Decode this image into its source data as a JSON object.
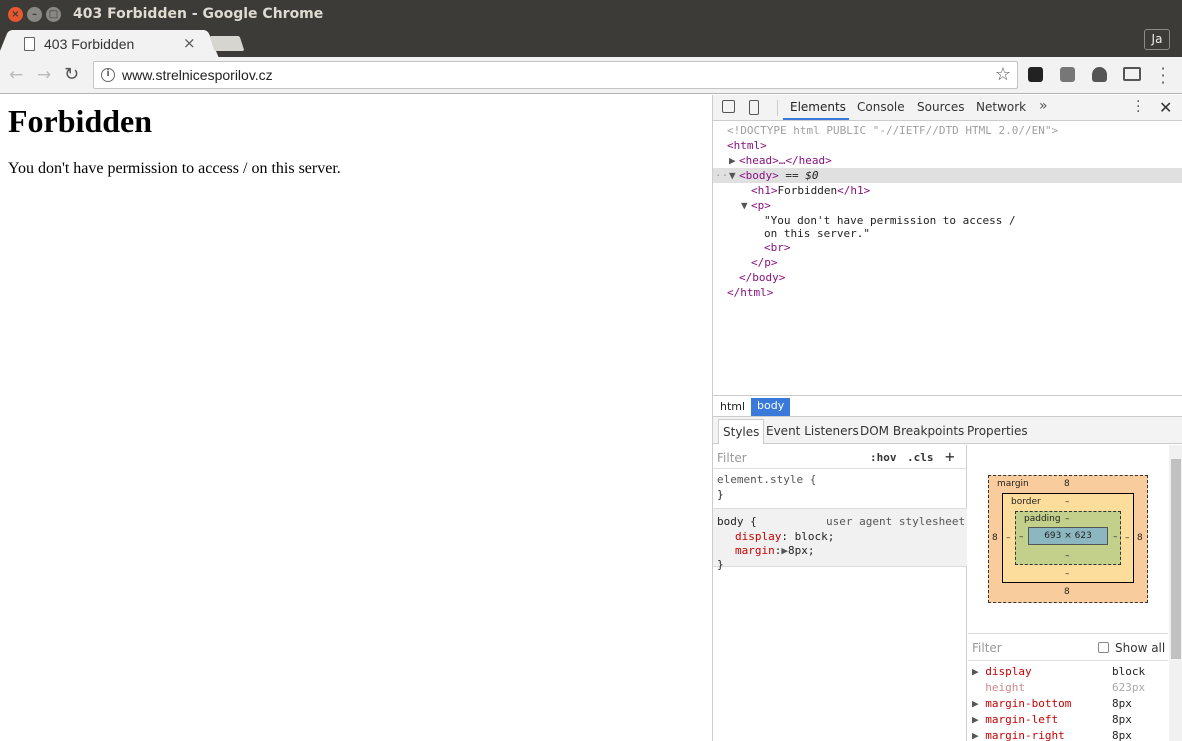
{
  "window": {
    "title": "403 Forbidden - Google Chrome"
  },
  "tab": {
    "title": "403 Forbidden",
    "close": "×"
  },
  "profile": {
    "label": "Ja"
  },
  "omnibox": {
    "url": "www.strelnicesporilov.cz"
  },
  "page": {
    "heading": "Forbidden",
    "message": "You don't have permission to access / on this server."
  },
  "devtools": {
    "tabs": [
      "Elements",
      "Console",
      "Sources",
      "Network"
    ],
    "more": "»",
    "dom": {
      "doctype": "<!DOCTYPE html PUBLIC \"-//IETF//DTD HTML 2.0//EN\">",
      "html_open": "<html>",
      "head": "<head>…</head>",
      "body_open": "<body>",
      "body_suffix": " == $0",
      "h1_open": "<h1>",
      "h1_text": "Forbidden",
      "h1_close": "</h1>",
      "p_open": "<p>",
      "p_text_1": "\"You don't have permission to access /",
      "p_text_2": "on this server.\"",
      "br": "<br>",
      "p_close": "</p>",
      "body_close": "</body>",
      "html_close": "</html>"
    },
    "breadcrumbs": [
      "html",
      "body"
    ],
    "subtabs": [
      "Styles",
      "Event Listeners",
      "DOM Breakpoints",
      "Properties"
    ],
    "styles": {
      "filter_placeholder": "Filter",
      "hov": ":hov",
      "cls": ".cls",
      "plus": "+",
      "element_style": "element.style {",
      "close_brace": "}",
      "body_selector": "body {",
      "ua_label": "user agent stylesheet",
      "decl1_prop": "display",
      "decl1_val": "block;",
      "decl2_prop": "margin",
      "decl2_val": "8px;"
    },
    "boxmodel": {
      "margin_label": "margin",
      "margin_top": "8",
      "margin_bottom": "8",
      "margin_left": "8",
      "margin_right": "8",
      "border_label": "border",
      "border_top": "–",
      "border_bottom": "–",
      "border_left": "–",
      "border_right": "–",
      "padding_label": "padding",
      "padding_top": "–",
      "padding_bottom": "–",
      "padding_left": "–",
      "padding_right": "–",
      "content": "693 × 623"
    },
    "computed": {
      "filter_placeholder": "Filter",
      "show_all": "Show all",
      "props": [
        {
          "name": "display",
          "value": "block"
        },
        {
          "name": "height",
          "value": "623px"
        },
        {
          "name": "margin-bottom",
          "value": "8px"
        },
        {
          "name": "margin-left",
          "value": "8px"
        },
        {
          "name": "margin-right",
          "value": "8px"
        }
      ]
    }
  }
}
